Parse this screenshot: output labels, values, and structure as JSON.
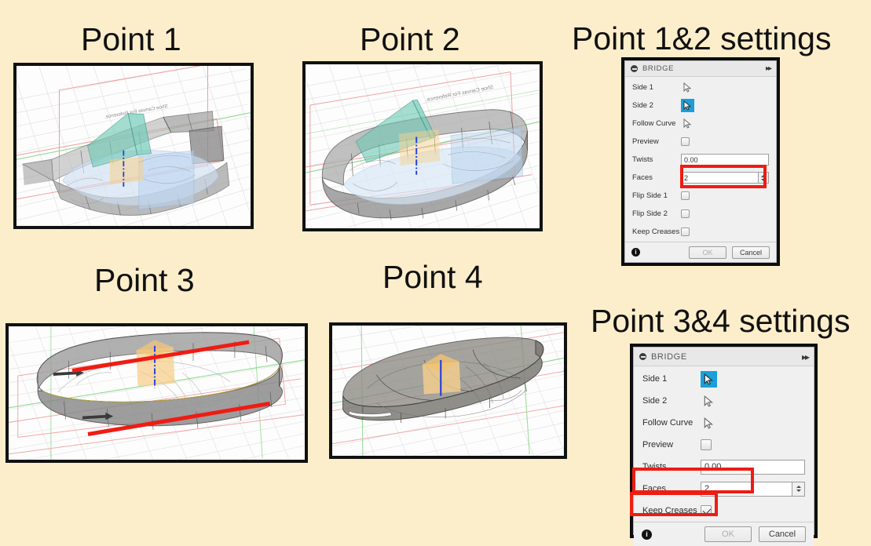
{
  "page": {
    "background_color": "#fdeecb",
    "accent_red": "#ee1c13",
    "accent_blue": "#1a9fda"
  },
  "headings": [
    {
      "id": "point1",
      "label": "Point 1"
    },
    {
      "id": "point2",
      "label": "Point 2"
    },
    {
      "id": "point12settings",
      "label": "Point 1&2 settings"
    },
    {
      "id": "point3",
      "label": "Point 3"
    },
    {
      "id": "point4",
      "label": "Point 4"
    },
    {
      "id": "point34settings",
      "label": "Point 3&4 settings"
    }
  ],
  "viewports": [
    {
      "id": "point1",
      "canvas_label": "Shoe Canvas For Reference."
    },
    {
      "id": "point2",
      "canvas_label": "Shoe Canvas For Reference."
    },
    {
      "id": "point3",
      "canvas_label": ""
    },
    {
      "id": "point4",
      "canvas_label": ""
    }
  ],
  "dialog_top": {
    "title": "BRIDGE",
    "expand_glyph": "▸▸",
    "rows": [
      {
        "label": "Side 1",
        "control": "select",
        "active": false
      },
      {
        "label": "Side 2",
        "control": "select",
        "active": true
      },
      {
        "label": "Follow Curve",
        "control": "select",
        "active": false
      },
      {
        "label": "Preview",
        "control": "checkbox",
        "checked": false
      },
      {
        "label": "Twists",
        "control": "text",
        "value": "0.00"
      },
      {
        "label": "Faces",
        "control": "spinner",
        "value": "2",
        "highlighted": true
      },
      {
        "label": "Flip Side 1",
        "control": "checkbox",
        "checked": false
      },
      {
        "label": "Flip Side 2",
        "control": "checkbox",
        "checked": false
      },
      {
        "label": "Keep Creases",
        "control": "checkbox",
        "checked": false
      }
    ],
    "footer": {
      "info_glyph": "i",
      "ok_label": "OK",
      "ok_disabled": true,
      "cancel_label": "Cancel"
    }
  },
  "dialog_bottom": {
    "title": "BRIDGE",
    "expand_glyph": "▸▸",
    "rows": [
      {
        "label": "Side 1",
        "control": "select",
        "active": true
      },
      {
        "label": "Side 2",
        "control": "select",
        "active": false
      },
      {
        "label": "Follow Curve",
        "control": "select",
        "active": false
      },
      {
        "label": "Preview",
        "control": "checkbox",
        "checked": false
      },
      {
        "label": "Twists",
        "control": "text",
        "value": "0.00"
      },
      {
        "label": "Faces",
        "control": "spinner",
        "value": "2",
        "highlighted": true
      },
      {
        "label": "Keep Creases",
        "control": "checkbox",
        "checked": true,
        "highlighted": true
      }
    ],
    "footer": {
      "info_glyph": "i",
      "ok_label": "OK",
      "ok_disabled": true,
      "cancel_label": "Cancel"
    }
  }
}
